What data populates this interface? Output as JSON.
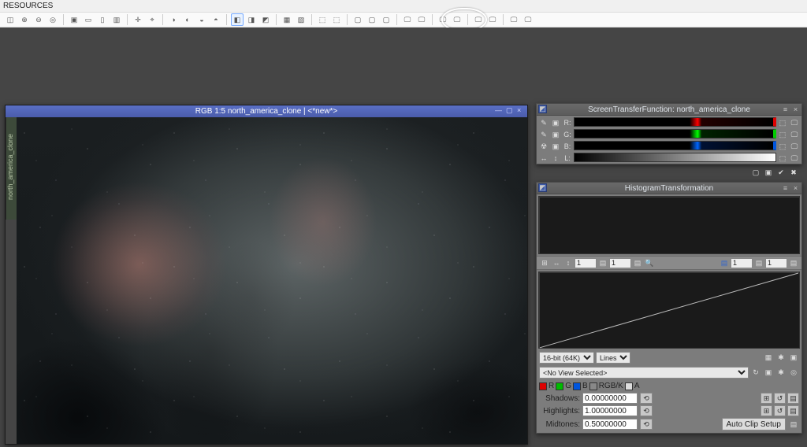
{
  "menubar": {
    "resources_label": "RESOURCES"
  },
  "toolbar": {
    "items": [
      {
        "name": "zoom-fit-icon",
        "g": "◫"
      },
      {
        "name": "zoom-in-icon",
        "g": "⊕"
      },
      {
        "name": "zoom-out-icon",
        "g": "⊖"
      },
      {
        "name": "zoom-1to1-icon",
        "g": "◎"
      },
      {
        "sep": true
      },
      {
        "name": "crop-icon",
        "g": "▣"
      },
      {
        "name": "preview-new-icon",
        "g": "▭"
      },
      {
        "name": "preview-del-icon",
        "g": "▯"
      },
      {
        "name": "preview-mod-icon",
        "g": "▥"
      },
      {
        "sep": true
      },
      {
        "name": "readout-icon",
        "g": "✛"
      },
      {
        "name": "probe-icon",
        "g": "⌖"
      },
      {
        "sep": true
      },
      {
        "name": "mask-show-icon",
        "g": "◑"
      },
      {
        "name": "mask-invert-icon",
        "g": "◐"
      },
      {
        "name": "mask-enable-icon",
        "g": "◒"
      },
      {
        "name": "mask-remove-icon",
        "g": "◓"
      },
      {
        "sep": true
      },
      {
        "name": "new-mask-icon",
        "g": "◧",
        "hi": true
      },
      {
        "name": "edit-mask-icon",
        "g": "◨"
      },
      {
        "name": "dup-mask-icon",
        "g": "◩"
      },
      {
        "sep": true
      },
      {
        "name": "process-a-icon",
        "g": "▦"
      },
      {
        "name": "process-b-icon",
        "g": "▧"
      },
      {
        "sep": true
      },
      {
        "name": "container-a-icon",
        "g": "⬚"
      },
      {
        "name": "container-b-icon",
        "g": "⬚"
      },
      {
        "sep": true
      },
      {
        "name": "screen-a-icon",
        "g": "▢"
      },
      {
        "name": "screen-b-icon",
        "g": "▢"
      },
      {
        "name": "screen-c-icon",
        "g": "▢"
      },
      {
        "sep": true
      },
      {
        "name": "display-blue-icon",
        "g": "🖵"
      },
      {
        "name": "display-black-icon",
        "g": "🖵"
      },
      {
        "sep": true
      },
      {
        "name": "stf-auto-icon",
        "g": "🖵"
      },
      {
        "name": "stf-link-icon",
        "g": "🖵"
      },
      {
        "sep": true
      },
      {
        "name": "stf-reset-icon",
        "g": "🖵"
      },
      {
        "name": "stf-boost-icon",
        "g": "🖵"
      },
      {
        "sep": true
      },
      {
        "name": "stf-apply-icon",
        "g": "🖵"
      },
      {
        "name": "stf-track-icon",
        "g": "🖵"
      }
    ]
  },
  "image_window": {
    "title": "RGB 1:5 north_america_clone | <*new*>",
    "sidebar_tab": "north_america_clone",
    "min": "—",
    "max": "▢",
    "close": "×"
  },
  "stf": {
    "title": "ScreenTransferFunction: north_america_clone",
    "rows": [
      {
        "label": "R:",
        "ch": "r",
        "edit": "✎",
        "track": "▣",
        "link": "⬚",
        "zoom": "🖵"
      },
      {
        "label": "G:",
        "ch": "g",
        "edit": "✎",
        "track": "▣",
        "link": "⬚",
        "zoom": "🖵"
      },
      {
        "label": "B:",
        "ch": "b",
        "edit": "☢",
        "track": "▣",
        "link": "⬚",
        "zoom": "🖵"
      },
      {
        "label": "L:",
        "ch": "l",
        "edit": "↔",
        "track": "↕",
        "link": "⬚",
        "zoom": "🖵"
      }
    ],
    "footer_icons": [
      "▢",
      "▣",
      "✔",
      "✖"
    ]
  },
  "hist": {
    "title": "HistogramTransformation",
    "zoomrow": {
      "v1": "1",
      "v2": "1",
      "v3": "1",
      "v4": "1"
    },
    "bitdepth_label": "16-bit (64K)",
    "plotmode_label": "Lines",
    "view_label": "<No View Selected>",
    "channels": {
      "r": "R",
      "g": "G",
      "b": "B",
      "rgbk": "RGB/K",
      "a": "A"
    },
    "shadows": {
      "label": "Shadows:",
      "value": "0.00000000"
    },
    "highlights": {
      "label": "Highlights:",
      "value": "1.00000000"
    },
    "midtones": {
      "label": "Midtones:",
      "value": "0.50000000"
    },
    "autoclip_label": "Auto Clip Setup",
    "row_icons": [
      "⊞",
      "↺",
      "▤"
    ],
    "close_icons": [
      "≡",
      "×"
    ]
  }
}
